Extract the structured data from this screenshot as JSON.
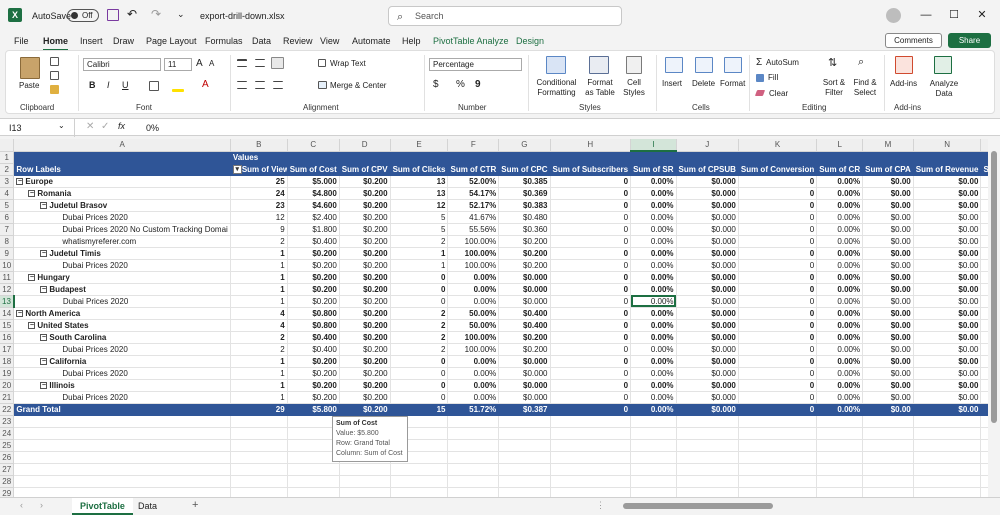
{
  "titlebar": {
    "app_logo": "X",
    "autosave_label": "AutoSave",
    "autosave_state": "Off",
    "file_name": "export-drill-down.xlsx",
    "search_placeholder": "Search"
  },
  "menu": {
    "tabs": [
      "File",
      "Home",
      "Insert",
      "Draw",
      "Page Layout",
      "Formulas",
      "Data",
      "Review",
      "View",
      "Automate",
      "Help",
      "PivotTable Analyze",
      "Design"
    ],
    "active_tab": "Home",
    "comments_label": "Comments",
    "share_label": "Share"
  },
  "ribbon": {
    "clipboard": {
      "paste": "Paste",
      "label": "Clipboard"
    },
    "font": {
      "name": "Calibri",
      "size": "11",
      "bold": "B",
      "italic": "I",
      "underline": "U",
      "label": "Font"
    },
    "alignment": {
      "wrap": "Wrap Text",
      "merge": "Merge & Center",
      "label": "Alignment"
    },
    "number": {
      "format": "Percentage",
      "currency": "$",
      "percent": "%",
      "comma": "9",
      "label": "Number"
    },
    "styles": {
      "cond": "Conditional Formatting",
      "table": "Format as Table",
      "cell": "Cell Styles",
      "label": "Styles"
    },
    "cells": {
      "insert": "Insert",
      "delete": "Delete",
      "format": "Format",
      "label": "Cells"
    },
    "editing": {
      "autosum": "AutoSum",
      "fill": "Fill",
      "clear": "Clear",
      "sort": "Sort & Filter",
      "find": "Find & Select",
      "label": "Editing"
    },
    "addins": {
      "addins": "Add-ins",
      "analyze": "Analyze Data",
      "label": "Add-ins"
    }
  },
  "formula_bar": {
    "name_box": "I13",
    "fx": "fx",
    "value": "0%"
  },
  "columns": [
    "A",
    "B",
    "C",
    "D",
    "E",
    "F",
    "G",
    "H",
    "I",
    "J",
    "K",
    "L",
    "M",
    "N",
    ""
  ],
  "headers": [
    "Row Labels",
    "Sum of Views",
    "Sum of Cost",
    "Sum of CPV",
    "Sum of Clicks",
    "Sum of CTR",
    "Sum of CPC",
    "Sum of Subscribers",
    "Sum of SR",
    "Sum of CPSUB",
    "Sum of Conversion",
    "Sum of CR",
    "Sum of CPA",
    "Sum of Revenue",
    "Sum o"
  ],
  "values_label": "Values",
  "rows": [
    {
      "label": "Europe",
      "level": 0,
      "toggle": "⊟",
      "style": "bold topline",
      "cells": [
        "25",
        "$5.000",
        "$0.200",
        "13",
        "52.00%",
        "$0.385",
        "0",
        "0.00%",
        "$0.000",
        "0",
        "0.00%",
        "$0.00",
        "$0.00",
        "$"
      ]
    },
    {
      "label": "Romania",
      "level": 1,
      "toggle": "⊟",
      "style": "bold",
      "cells": [
        "24",
        "$4.800",
        "$0.200",
        "13",
        "54.17%",
        "$0.369",
        "0",
        "0.00%",
        "$0.000",
        "0",
        "0.00%",
        "$0.00",
        "$0.00",
        "$"
      ]
    },
    {
      "label": "Judetul Brasov",
      "level": 2,
      "toggle": "⊟",
      "style": "bold",
      "cells": [
        "23",
        "$4.600",
        "$0.200",
        "12",
        "52.17%",
        "$0.383",
        "0",
        "0.00%",
        "$0.000",
        "0",
        "0.00%",
        "$0.00",
        "$0.00",
        "$"
      ]
    },
    {
      "label": "Dubai Prices 2020",
      "level": 3,
      "toggle": "",
      "style": "",
      "cells": [
        "12",
        "$2.400",
        "$0.200",
        "5",
        "41.67%",
        "$0.480",
        "0",
        "0.00%",
        "$0.000",
        "0",
        "0.00%",
        "$0.00",
        "$0.00",
        "$"
      ]
    },
    {
      "label": "Dubai Prices 2020 No Custom Tracking Domai",
      "level": 3,
      "toggle": "",
      "style": "",
      "cells": [
        "9",
        "$1.800",
        "$0.200",
        "5",
        "55.56%",
        "$0.360",
        "0",
        "0.00%",
        "$0.000",
        "0",
        "0.00%",
        "$0.00",
        "$0.00",
        "$"
      ]
    },
    {
      "label": "whatismyreferer.com",
      "level": 3,
      "toggle": "",
      "style": "",
      "cells": [
        "2",
        "$0.400",
        "$0.200",
        "2",
        "100.00%",
        "$0.200",
        "0",
        "0.00%",
        "$0.000",
        "0",
        "0.00%",
        "$0.00",
        "$0.00",
        "$"
      ]
    },
    {
      "label": "Judetul Timis",
      "level": 2,
      "toggle": "⊟",
      "style": "bold",
      "cells": [
        "1",
        "$0.200",
        "$0.200",
        "1",
        "100.00%",
        "$0.200",
        "0",
        "0.00%",
        "$0.000",
        "0",
        "0.00%",
        "$0.00",
        "$0.00",
        "$"
      ]
    },
    {
      "label": "Dubai Prices 2020",
      "level": 3,
      "toggle": "",
      "style": "",
      "cells": [
        "1",
        "$0.200",
        "$0.200",
        "1",
        "100.00%",
        "$0.200",
        "0",
        "0.00%",
        "$0.000",
        "0",
        "0.00%",
        "$0.00",
        "$0.00",
        "$"
      ]
    },
    {
      "label": "Hungary",
      "level": 1,
      "toggle": "⊟",
      "style": "bold",
      "cells": [
        "1",
        "$0.200",
        "$0.200",
        "0",
        "0.00%",
        "$0.000",
        "0",
        "0.00%",
        "$0.000",
        "0",
        "0.00%",
        "$0.00",
        "$0.00",
        "$"
      ]
    },
    {
      "label": "Budapest",
      "level": 2,
      "toggle": "⊟",
      "style": "bold",
      "cells": [
        "1",
        "$0.200",
        "$0.200",
        "0",
        "0.00%",
        "$0.000",
        "0",
        "0.00%",
        "$0.000",
        "0",
        "0.00%",
        "$0.00",
        "$0.00",
        "$"
      ]
    },
    {
      "label": "Dubai Prices 2020",
      "level": 3,
      "toggle": "",
      "style": "",
      "cells": [
        "1",
        "$0.200",
        "$0.200",
        "0",
        "0.00%",
        "$0.000",
        "0",
        "0.00%",
        "$0.000",
        "0",
        "0.00%",
        "$0.00",
        "$0.00",
        "$"
      ]
    },
    {
      "label": "North America",
      "level": 0,
      "toggle": "⊟",
      "style": "bold topline",
      "cells": [
        "4",
        "$0.800",
        "$0.200",
        "2",
        "50.00%",
        "$0.400",
        "0",
        "0.00%",
        "$0.000",
        "0",
        "0.00%",
        "$0.00",
        "$0.00",
        "$"
      ]
    },
    {
      "label": "United States",
      "level": 1,
      "toggle": "⊟",
      "style": "bold",
      "cells": [
        "4",
        "$0.800",
        "$0.200",
        "2",
        "50.00%",
        "$0.400",
        "0",
        "0.00%",
        "$0.000",
        "0",
        "0.00%",
        "$0.00",
        "$0.00",
        "$"
      ]
    },
    {
      "label": "South Carolina",
      "level": 2,
      "toggle": "⊟",
      "style": "bold",
      "cells": [
        "2",
        "$0.400",
        "$0.200",
        "2",
        "100.00%",
        "$0.200",
        "0",
        "0.00%",
        "$0.000",
        "0",
        "0.00%",
        "$0.00",
        "$0.00",
        "$"
      ]
    },
    {
      "label": "Dubai Prices 2020",
      "level": 3,
      "toggle": "",
      "style": "",
      "cells": [
        "2",
        "$0.400",
        "$0.200",
        "2",
        "100.00%",
        "$0.200",
        "0",
        "0.00%",
        "$0.000",
        "0",
        "0.00%",
        "$0.00",
        "$0.00",
        "$"
      ]
    },
    {
      "label": "California",
      "level": 2,
      "toggle": "⊟",
      "style": "bold",
      "cells": [
        "1",
        "$0.200",
        "$0.200",
        "0",
        "0.00%",
        "$0.000",
        "0",
        "0.00%",
        "$0.000",
        "0",
        "0.00%",
        "$0.00",
        "$0.00",
        "$"
      ]
    },
    {
      "label": "Dubai Prices 2020",
      "level": 3,
      "toggle": "",
      "style": "",
      "cells": [
        "1",
        "$0.200",
        "$0.200",
        "0",
        "0.00%",
        "$0.000",
        "0",
        "0.00%",
        "$0.000",
        "0",
        "0.00%",
        "$0.00",
        "$0.00",
        "$"
      ]
    },
    {
      "label": "Illinois",
      "level": 2,
      "toggle": "⊟",
      "style": "bold",
      "cells": [
        "1",
        "$0.200",
        "$0.200",
        "0",
        "0.00%",
        "$0.000",
        "0",
        "0.00%",
        "$0.000",
        "0",
        "0.00%",
        "$0.00",
        "$0.00",
        "$"
      ]
    },
    {
      "label": "Dubai Prices 2020",
      "level": 3,
      "toggle": "",
      "style": "",
      "cells": [
        "1",
        "$0.200",
        "$0.200",
        "0",
        "0.00%",
        "$0.000",
        "0",
        "0.00%",
        "$0.000",
        "0",
        "0.00%",
        "$0.00",
        "$0.00",
        "$"
      ]
    },
    {
      "label": "Grand Total",
      "level": 0,
      "toggle": "",
      "style": "total",
      "cells": [
        "29",
        "$5.800",
        "$0.200",
        "15",
        "51.72%",
        "$0.387",
        "0",
        "0.00%",
        "$0.000",
        "0",
        "0.00%",
        "$0.00",
        "$0.00",
        "$"
      ]
    }
  ],
  "empty_rows": [
    "23",
    "24",
    "25",
    "26",
    "27",
    "28",
    "29"
  ],
  "tooltip": {
    "title": "Sum of Cost",
    "value": "Value: $5.800",
    "row": "Row: Grand Total",
    "column": "Column: Sum of Cost"
  },
  "sheets": {
    "tabs": [
      "PivotTable",
      "Data"
    ],
    "active": "PivotTable",
    "add": "+"
  },
  "colors": {
    "pivot_header": "#2f5597",
    "accent": "#1d6f42"
  }
}
